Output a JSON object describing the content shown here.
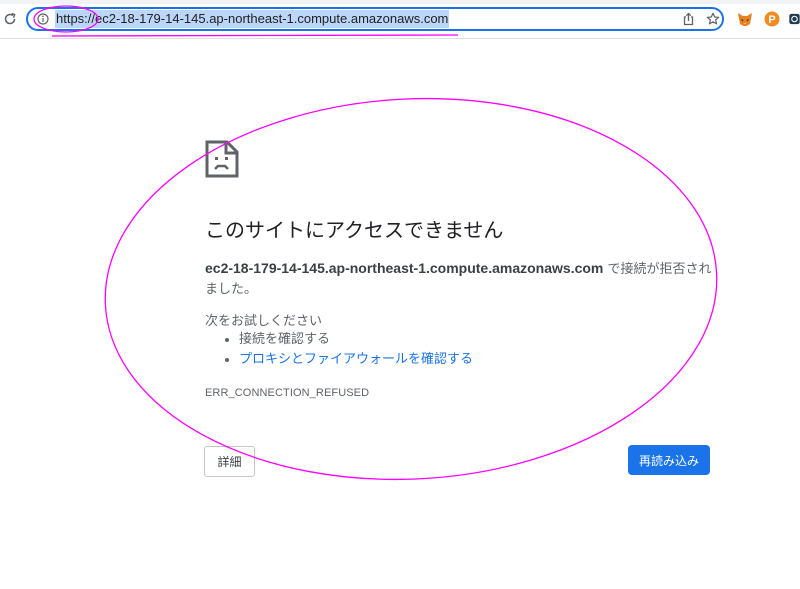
{
  "browser": {
    "url": "https://ec2-18-179-14-145.ap-northeast-1.compute.amazonaws.com",
    "icons": {
      "reload": "reload-icon",
      "site_info": "site-info-icon",
      "share": "share-icon",
      "bookmark": "star-icon",
      "extensions": [
        "metamask-fox-icon",
        "p-extension-icon",
        "extension-icon"
      ]
    }
  },
  "error_page": {
    "icon": "sad-page-icon",
    "headline": "このサイトにアクセスできません",
    "host": "ec2-18-179-14-145.ap-northeast-1.compute.amazonaws.com",
    "description_suffix": " で接続が拒否されました。",
    "suggestions_heading": "次をお試しください",
    "suggestions": [
      "接続を確認する",
      "プロキシとファイアウォールを確認する"
    ],
    "error_code": "ERR_CONNECTION_REFUSED",
    "details_button": "詳細",
    "reload_button": "再読み込み"
  },
  "colors": {
    "accent": "#1a73e8",
    "annotation": "#ff00ff",
    "url_highlight": "#bcd6f7",
    "text_primary": "#202124",
    "text_secondary": "#5f6368"
  }
}
